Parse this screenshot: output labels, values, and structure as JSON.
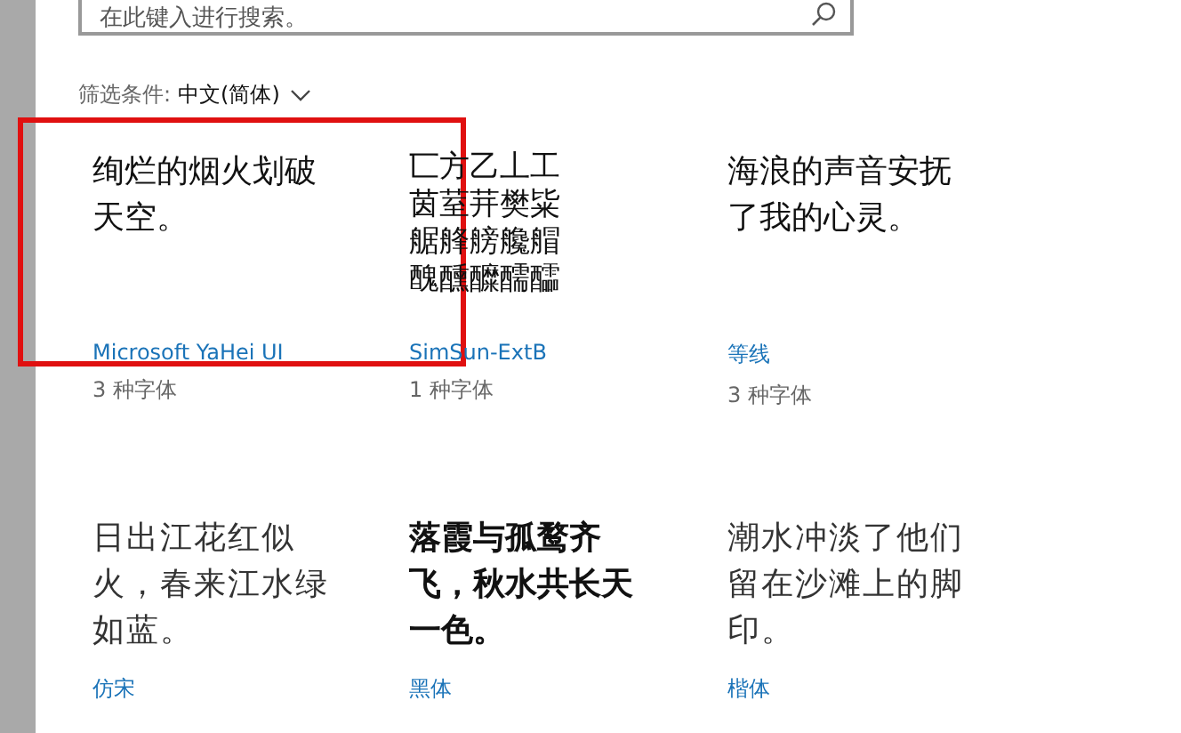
{
  "search": {
    "placeholder": "在此键入进行搜索。"
  },
  "filter": {
    "label": "筛选条件:",
    "value": "中文(简体)"
  },
  "fonts": [
    {
      "sample": "绚烂的烟火划破天空。",
      "name": "Microsoft YaHei UI",
      "count": "3 种字体",
      "kind": "sans",
      "highlighted": true
    },
    {
      "sample": "匸方乙丄工茵荎茾樊粊艍艂艕艬艒醜醺醾醹醽",
      "name": "SimSun-ExtB",
      "count": "1 种字体",
      "kind": "thin",
      "highlighted": false
    },
    {
      "sample": "海浪的声音安抚了我的心灵。",
      "name": "等线",
      "count": "3 种字体",
      "kind": "sans",
      "highlighted": false
    },
    {
      "sample": "日出江花红似火，春来江水绿如蓝。",
      "name": "仿宋",
      "kind": "serif",
      "highlighted": false
    },
    {
      "sample": "落霞与孤鹜齐飞，秋水共长天一色。",
      "name": "黑体",
      "kind": "bold",
      "highlighted": false
    },
    {
      "sample": "潮水冲淡了他们留在沙滩上的脚印。",
      "name": "楷体",
      "kind": "serif",
      "highlighted": false
    }
  ]
}
